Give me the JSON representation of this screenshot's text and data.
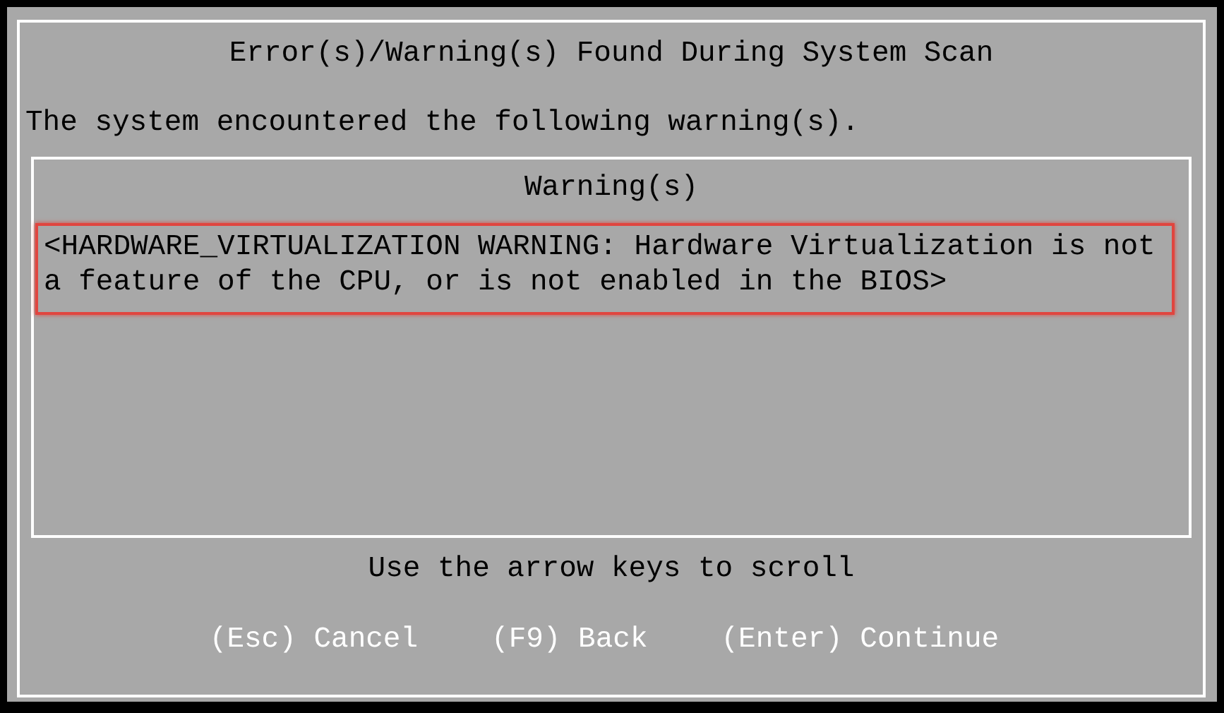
{
  "dialog": {
    "title": "Error(s)/Warning(s) Found During System Scan",
    "message": "The system encountered the following warning(s).",
    "warnings_box": {
      "heading": "Warning(s)",
      "warnings": [
        {
          "text": "<HARDWARE_VIRTUALIZATION WARNING: Hardware Virtualization is not a feature of the CPU, or is not enabled in the BIOS>",
          "highlighted": true
        }
      ]
    },
    "hint": "Use the arrow keys to scroll",
    "actions": [
      {
        "label": "(Esc) Cancel"
      },
      {
        "label": "(F9) Back"
      },
      {
        "label": "(Enter) Continue"
      }
    ]
  }
}
